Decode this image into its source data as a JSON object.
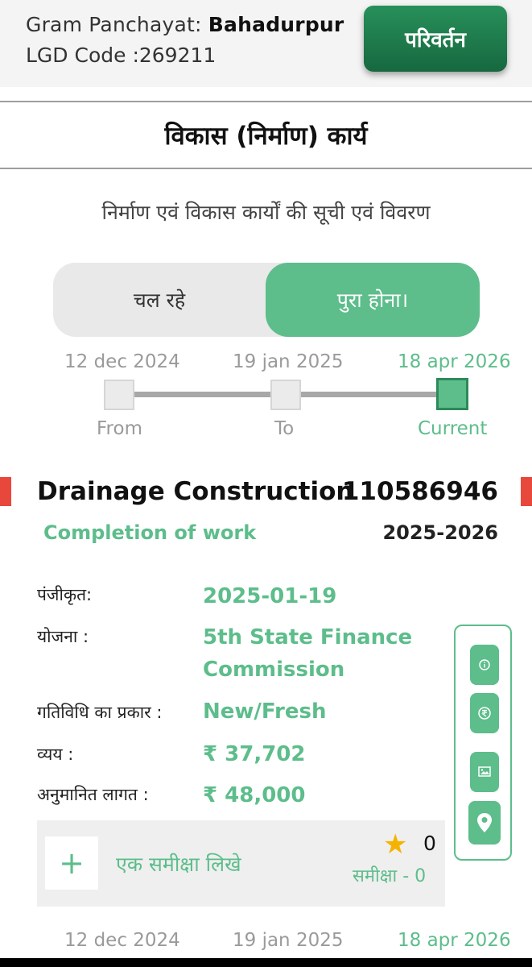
{
  "header": {
    "gp_prefix": "Gram Panchayat: ",
    "gp_name": "Bahadurpur",
    "lgd_label": "LGD Code :",
    "lgd_code": "269211",
    "change_button": "परिवर्तन"
  },
  "page_title": "विकास (निर्माण) कार्य",
  "subtitle": "निर्माण एवं विकास कार्यों की सूची एवं विवरण",
  "toggle": {
    "ongoing": "चल रहे",
    "completed": "पुरा होना।",
    "active": "completed"
  },
  "timeline": {
    "from_date": "12 dec 2024",
    "to_date": "19 jan 2025",
    "current_date": "18 apr 2026",
    "from_label": "From",
    "to_label": "To",
    "current_label": "Current"
  },
  "work": {
    "title": "Drainage Construction",
    "id": "110586946",
    "status": "Completion of work",
    "year": "2025-2026",
    "registered_label": "पंजीकृत:",
    "registered_value": "2025-01-19",
    "scheme_label": "योजना :",
    "scheme_value": "5th State Finance Commission",
    "activity_label": "गतिविधि का प्रकार :",
    "activity_value": "New/Fresh",
    "expense_label": "व्यय :",
    "expense_value": "₹ 37,702",
    "estimate_label": "अनुमानित लागत :",
    "estimate_value": "₹ 48,000"
  },
  "side_actions": [
    "info-icon",
    "rupee-icon",
    "image-icon",
    "location-pin-icon"
  ],
  "review": {
    "write_label": "एक समीक्षा लिखे",
    "plus": "+",
    "star_count": "0",
    "review_label": "समीक्षा - 0"
  },
  "next_timeline": {
    "from_date": "12 dec 2024",
    "to_date": "19 jan 2025",
    "current_date": "18 apr 2026"
  },
  "colors": {
    "accent": "#5dbd8b",
    "button": "#1f7a4b",
    "marker": "#e8473c",
    "star": "#f5b301"
  }
}
